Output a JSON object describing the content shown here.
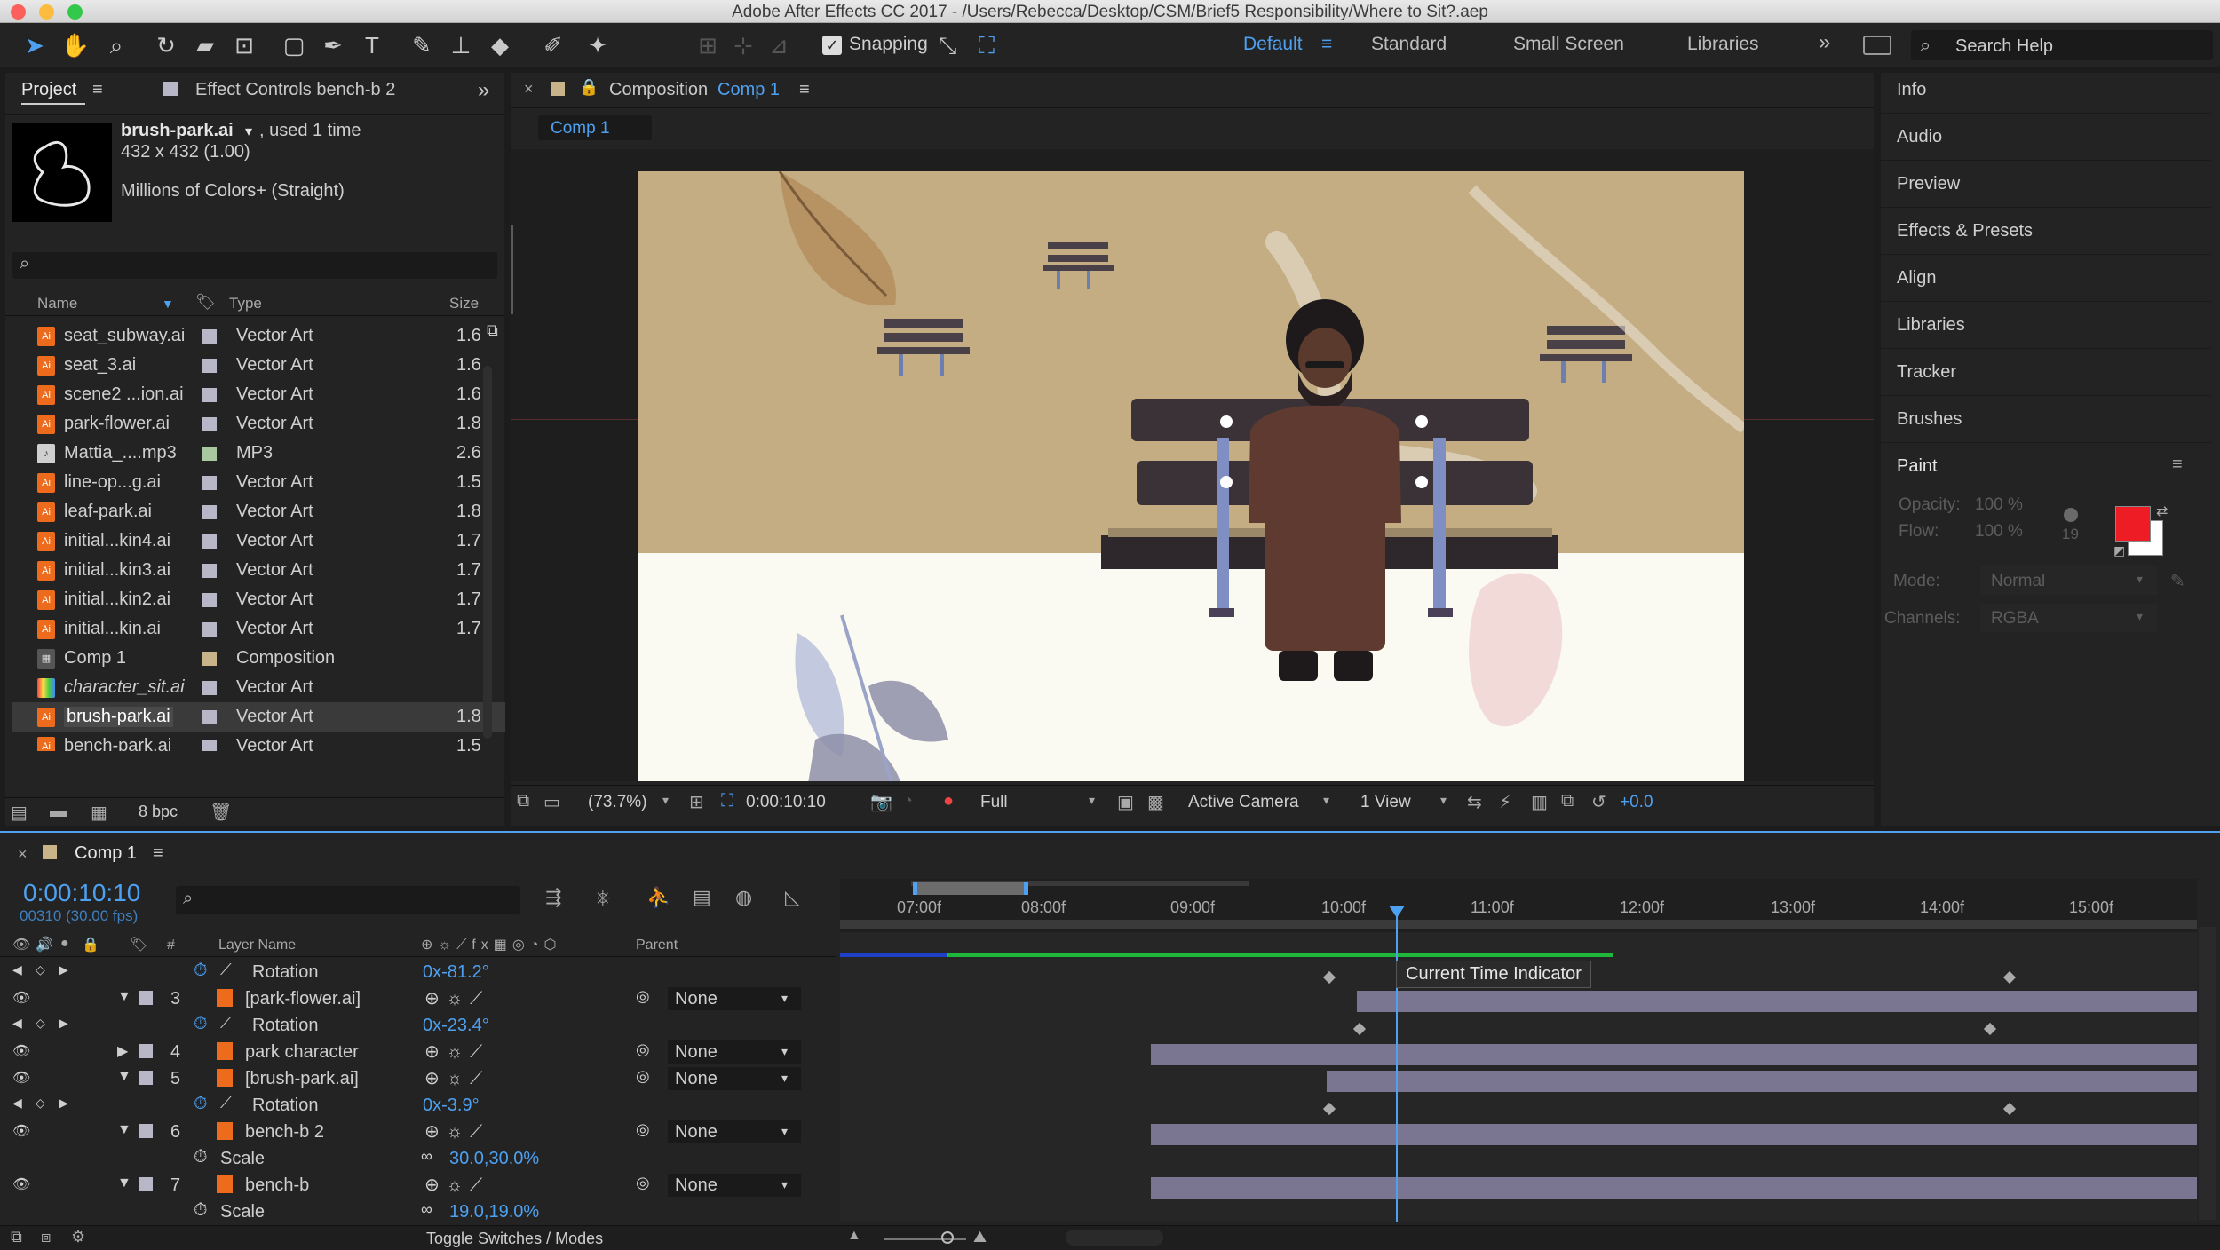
{
  "window": {
    "title": "Adobe After Effects CC 2017 - /Users/Rebecca/Desktop/CSM/Brief5 Responsibility/Where to Sit?.aep"
  },
  "toolbar": {
    "snapping_label": "Snapping",
    "workspaces": [
      "Default",
      "Standard",
      "Small Screen",
      "Libraries"
    ],
    "search_placeholder": "Search Help",
    "icons": [
      "selection-tool",
      "hand-tool",
      "zoom-tool",
      "rotate-tool",
      "camera-tool",
      "pan-behind-tool",
      "rectangle-tool",
      "pen-tool",
      "type-tool",
      "brush-tool",
      "clone-stamp-tool",
      "eraser-tool",
      "roto-brush-tool",
      "puppet-tool"
    ]
  },
  "project": {
    "tab_project": "Project",
    "tab_effect": "Effect Controls bench-b 2",
    "asset_name": "brush-park.ai",
    "asset_used": ", used 1 time",
    "asset_dims": "432 x 432 (1.00)",
    "asset_colors": "Millions of Colors+ (Straight)",
    "columns": {
      "name": "Name",
      "type": "Type",
      "size": "Size"
    },
    "items": [
      {
        "name": "seat_subway.ai",
        "type": "Vector Art",
        "size": "1.6"
      },
      {
        "name": "seat_3.ai",
        "type": "Vector Art",
        "size": "1.6"
      },
      {
        "name": "scene2 ...ion.ai",
        "type": "Vector Art",
        "size": "1.6"
      },
      {
        "name": "park-flower.ai",
        "type": "Vector Art",
        "size": "1.8"
      },
      {
        "name": "Mattia_....mp3",
        "type": "MP3",
        "size": "2.6"
      },
      {
        "name": "line-op...g.ai",
        "type": "Vector Art",
        "size": "1.5"
      },
      {
        "name": "leaf-park.ai",
        "type": "Vector Art",
        "size": "1.8"
      },
      {
        "name": "initial...kin4.ai",
        "type": "Vector Art",
        "size": "1.7"
      },
      {
        "name": "initial...kin3.ai",
        "type": "Vector Art",
        "size": "1.7"
      },
      {
        "name": "initial...kin2.ai",
        "type": "Vector Art",
        "size": "1.7"
      },
      {
        "name": "initial...kin.ai",
        "type": "Vector Art",
        "size": "1.7"
      },
      {
        "name": "Comp 1",
        "type": "Composition",
        "size": ""
      },
      {
        "name": "character_sit.ai",
        "type": "Vector Art",
        "size": ""
      },
      {
        "name": "brush-park.ai",
        "type": "Vector Art",
        "size": "1.8"
      },
      {
        "name": "bench-park.ai",
        "type": "Vector Art",
        "size": "1.5"
      }
    ],
    "bpc": "8 bpc"
  },
  "composition": {
    "tab_prefix": "Composition",
    "tab_name": "Comp 1",
    "sub_tab": "Comp 1",
    "zoom": "(73.7%)",
    "timecode": "0:00:10:10",
    "resolution": "Full",
    "camera": "Active Camera",
    "views": "1 View",
    "exposure": "+0.0"
  },
  "right_panels": [
    "Info",
    "Audio",
    "Preview",
    "Effects & Presets",
    "Align",
    "Libraries",
    "Tracker",
    "Brushes"
  ],
  "paint": {
    "title": "Paint",
    "opacity_label": "Opacity:",
    "opacity": "100 %",
    "flow_label": "Flow:",
    "flow": "100 %",
    "brush_size": "19",
    "mode_label": "Mode:",
    "mode": "Normal",
    "channels_label": "Channels:",
    "channels": "RGBA",
    "fg_color": "#ee1c24",
    "bg_color": "#ffffff"
  },
  "timeline": {
    "tab": "Comp 1",
    "timecode": "0:00:10:10",
    "frame_info": "00310 (30.00 fps)",
    "col_hash": "#",
    "col_layer_name": "Layer Name",
    "col_parent": "Parent",
    "ruler": [
      "07:00f",
      "08:00f",
      "09:00f",
      "10:00f",
      "11:00f",
      "12:00f",
      "13:00f",
      "14:00f",
      "15:00f"
    ],
    "tooltip": "Current Time Indicator",
    "toggle_label": "Toggle Switches / Modes",
    "rows": [
      {
        "kind": "prop",
        "label": "Rotation",
        "value": "0x-81.2°"
      },
      {
        "kind": "layer",
        "num": "3",
        "label": "[park-flower.ai]",
        "parent": "None"
      },
      {
        "kind": "prop",
        "label": "Rotation",
        "value": "0x-23.4°"
      },
      {
        "kind": "layer",
        "num": "4",
        "label": "park character",
        "parent": "None"
      },
      {
        "kind": "layer",
        "num": "5",
        "label": "[brush-park.ai]",
        "parent": "None"
      },
      {
        "kind": "prop",
        "label": "Rotation",
        "value": "0x-3.9°"
      },
      {
        "kind": "layer",
        "num": "6",
        "label": "bench-b 2",
        "parent": "None"
      },
      {
        "kind": "prop",
        "label": "Scale",
        "value": "30.0,30.0%"
      },
      {
        "kind": "layer",
        "num": "7",
        "label": "bench-b",
        "parent": "None"
      },
      {
        "kind": "prop",
        "label": "Scale",
        "value": "19.0,19.0%"
      }
    ]
  }
}
